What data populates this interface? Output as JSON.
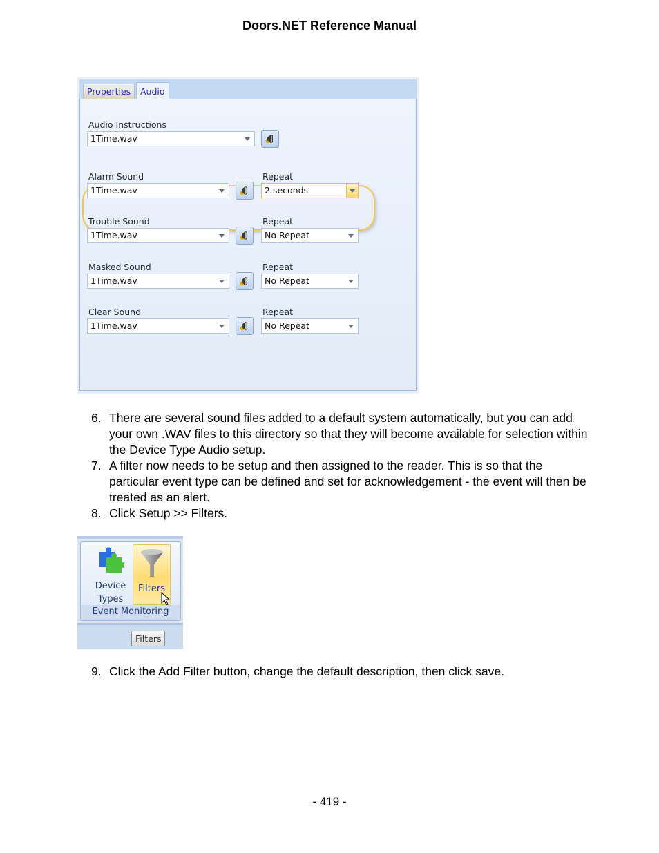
{
  "header": {
    "title": "Doors.NET Reference Manual"
  },
  "audio_panel": {
    "tabs": [
      {
        "label": "Properties",
        "active": false
      },
      {
        "label": "Audio",
        "active": true
      }
    ],
    "audio_instructions": {
      "label": "Audio Instructions",
      "value": "1Time.wav"
    },
    "rows": [
      {
        "sound_label": "Alarm Sound",
        "sound_value": "1Time.wav",
        "repeat_label": "Repeat",
        "repeat_value": "2 seconds",
        "highlighted": true
      },
      {
        "sound_label": "Trouble Sound",
        "sound_value": "1Time.wav",
        "repeat_label": "Repeat",
        "repeat_value": "No Repeat",
        "highlighted": false
      },
      {
        "sound_label": "Masked Sound",
        "sound_value": "1Time.wav",
        "repeat_label": "Repeat",
        "repeat_value": "No Repeat",
        "highlighted": false
      },
      {
        "sound_label": "Clear Sound",
        "sound_value": "1Time.wav",
        "repeat_label": "Repeat",
        "repeat_value": "No Repeat",
        "highlighted": false
      }
    ],
    "highlight_color": "#f3c94a",
    "speaker_icon": "speaker-icon"
  },
  "steps_a": [
    {
      "num": "6.",
      "text": "There are several sound files added to a default system automatically, but you can add your own .WAV files to this directory so that they will become available for selection within the Device Type Audio setup."
    },
    {
      "num": "7.",
      "text": "A filter now needs to be setup and then assigned to the reader. This is so that the particular event type can be defined and set for acknowledgement - the event will then be treated as an alert."
    },
    {
      "num": "8.",
      "text": "Click Setup >> Filters."
    }
  ],
  "ribbon": {
    "device_types_line1": "Device",
    "device_types_line2": "Types",
    "filters_label": "Filters",
    "group_label": "Event Monitoring",
    "tab_label": "Filters",
    "device_types_icon": "puzzle-icon",
    "filters_icon": "funnel-icon"
  },
  "steps_b": [
    {
      "num": "9.",
      "text": "Click the Add Filter button, change the default description, then click save."
    }
  ],
  "footer": {
    "page": "- 419 -"
  }
}
